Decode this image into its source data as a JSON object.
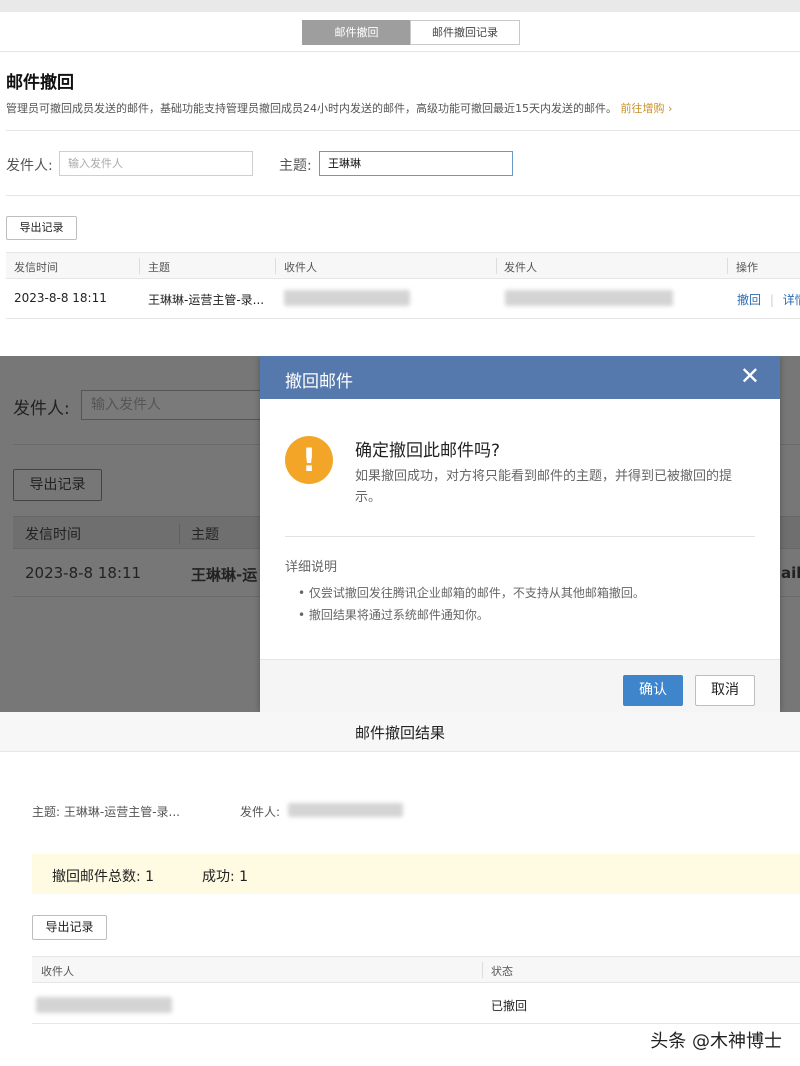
{
  "panel1": {
    "tabs": [
      "邮件撤回",
      "邮件撤回记录"
    ],
    "title": "邮件撤回",
    "description": "管理员可撤回成员发送的邮件，基础功能支持管理员撤回成员24小时内发送的邮件，高级功能可撤回最近15天内发送的邮件。",
    "upgrade_link": "前往增购",
    "upgrade_chevron": "›",
    "sender_label": "发件人:",
    "sender_placeholder": "输入发件人",
    "subject_label": "主题:",
    "subject_value": "王琳琳",
    "export_button": "导出记录",
    "columns": [
      "发信时间",
      "主题",
      "收件人",
      "发件人",
      "操作"
    ],
    "row": {
      "time": "2023-8-8 18:11",
      "subject": "王琳琳-运营主管-录...",
      "action_recall": "撤回",
      "action_sep": "|",
      "action_detail": "详情"
    }
  },
  "panel2": {
    "bg_sender_label": "发件人:",
    "bg_sender_placeholder": "输入发件人",
    "bg_export": "导出记录",
    "bg_col_time": "发信时间",
    "bg_col_subject": "主题",
    "bg_row_time": "2023-8-8 18:11",
    "bg_row_subject": "王琳琳-运",
    "bg_row_tail": "ail.",
    "modal": {
      "title": "撤回邮件",
      "close": "✕",
      "warning_glyph": "!",
      "question": "确定撤回此邮件吗?",
      "question_desc": "如果撤回成功，对方将只能看到邮件的主题，并得到已被撤回的提示。",
      "detail_title": "详细说明",
      "bullets": [
        "• 仅尝试撤回发往腾讯企业邮箱的邮件，不支持从其他邮箱撤回。",
        "• 撤回结果将通过系统邮件通知你。"
      ],
      "confirm": "确认",
      "cancel": "取消"
    }
  },
  "panel3": {
    "title": "邮件撤回结果",
    "subject_meta": "主题: 王琳琳-运营主管-录...",
    "sender_meta": "发件人:",
    "total_label": "撤回邮件总数: 1",
    "success_label": "成功: 1",
    "export_button": "导出记录",
    "columns": [
      "收件人",
      "状态"
    ],
    "row_status": "已撤回",
    "watermark": "头条 @木神博士"
  },
  "colors": {
    "modal_header": "#5679ad",
    "confirm_button": "#3f85cc",
    "warning": "#f3a527",
    "upgrade_link": "#c8902c",
    "notice_bg": "#fffbe3"
  }
}
